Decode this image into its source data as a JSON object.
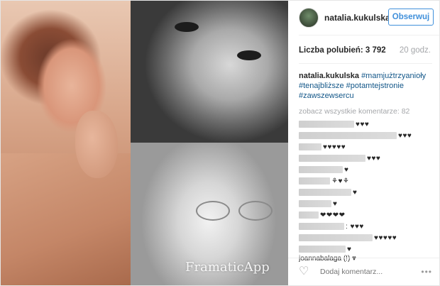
{
  "post": {
    "username": "natalia.kukulska",
    "follow_label": "Obserwuj",
    "likes": "Liczba polubień: 3 792",
    "time": "20 godz.",
    "watermark": "FramaticApp",
    "caption": {
      "user": "natalia.kukulska",
      "tags": [
        "#mamjużtrzyanioły",
        "#tenajbliższe",
        "#potamtejstronie",
        "#zawszewsercu"
      ]
    },
    "view_all": "zobacz wszystkie komentarze: 82",
    "comments": [
      {
        "hearts": "♥♥♥"
      },
      {
        "hearts": "♥♥♥"
      },
      {
        "hearts": "♥♥♥♥♥"
      },
      {
        "hearts": "♥♥♥"
      },
      {
        "hearts": "♥"
      },
      {
        "hearts": "⚘♥⚘"
      },
      {
        "hearts": "♥"
      },
      {
        "hearts": "♥"
      },
      {
        "hearts": "❤❤❤❤"
      },
      {
        "hearts": ": ♥♥♥"
      },
      {
        "hearts": "♥♥♥♥♥"
      },
      {
        "hearts": "♥"
      }
    ],
    "last_comment": "joannabalaga (!) ♥",
    "add_comment_placeholder": "Dodaj komentarz...",
    "icons": {
      "like": "heart-outline-icon",
      "more": "more-options-icon"
    }
  }
}
